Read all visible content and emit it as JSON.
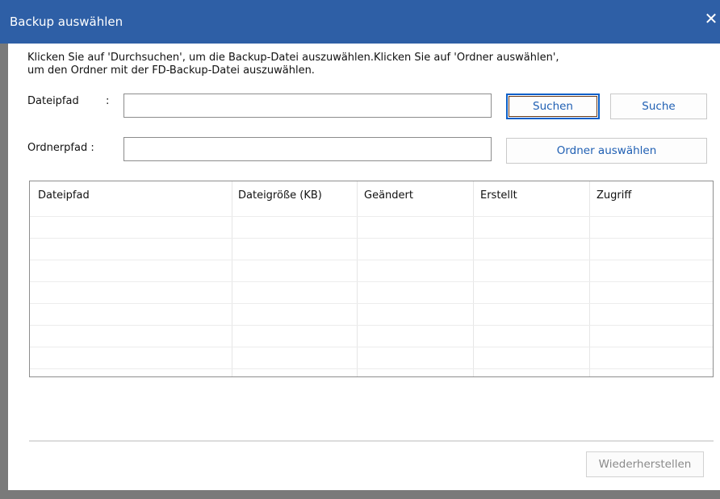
{
  "window": {
    "title": "Backup auswählen",
    "close_glyph": "✕",
    "titlebar_color": "#2e5fa6",
    "close_icon": "close-icon"
  },
  "instruction": {
    "line1": "Klicken Sie auf 'Durchsuchen', um die Backup-Datei auszuwählen.Klicken Sie auf 'Ordner auswählen',",
    "line2": "um den Ordner mit der FD-Backup-Datei auszuwählen."
  },
  "file_path": {
    "label": "Dateipfad",
    "colon": ":",
    "value": "",
    "placeholder": ""
  },
  "folder_path": {
    "label": "Ordnerpfad :",
    "value": "",
    "placeholder": ""
  },
  "buttons": {
    "search_focused": "Suchen",
    "search": "Suche",
    "select_folder": "Ordner auswählen",
    "restore": "Wiederherstellen"
  },
  "table": {
    "columns": [
      "Dateipfad",
      "Dateigröße (KB)",
      "Geändert",
      "Erstellt",
      "Zugriff"
    ],
    "rows": []
  },
  "colors": {
    "accent": "#2e5fa6",
    "link_text": "#1f5fb3",
    "focus_border": "#0a5fc8"
  }
}
